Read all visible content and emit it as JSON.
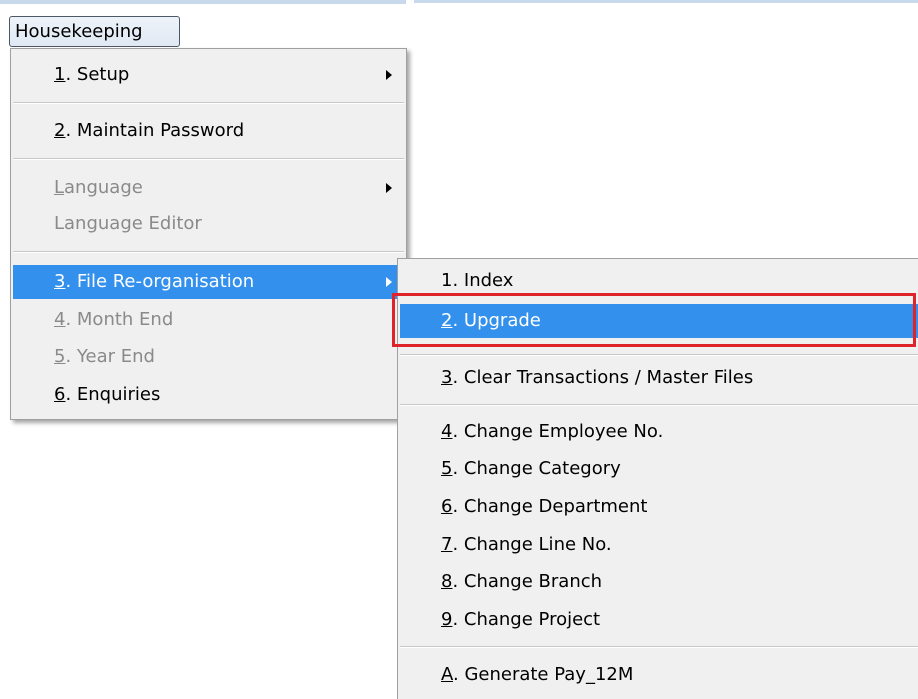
{
  "menubar": {
    "label": "Housekeeping"
  },
  "menu": {
    "items": [
      {
        "mn": "1",
        "rest": ". Setup",
        "submenu": true,
        "disabled": false
      },
      {
        "mn": "2",
        "rest": ". Maintain Password",
        "submenu": false,
        "disabled": false
      },
      {
        "mn": "L",
        "rest": "anguage",
        "submenu": true,
        "disabled": true
      },
      {
        "mn": "",
        "rest": "Language Editor",
        "submenu": false,
        "disabled": true
      },
      {
        "mn": "3",
        "rest": ". File Re-organisation",
        "submenu": true,
        "disabled": false,
        "highlighted": true
      },
      {
        "mn": "4",
        "rest": ". Month End",
        "submenu": false,
        "disabled": true
      },
      {
        "mn": "5",
        "rest": ". Year End",
        "submenu": false,
        "disabled": true
      },
      {
        "mn": "6",
        "rest": ". Enquiries",
        "submenu": false,
        "disabled": false
      }
    ]
  },
  "submenu": {
    "items": [
      {
        "mn": "",
        "rest": "1. Index"
      },
      {
        "mn": "2",
        "rest": ". Upgrade",
        "highlighted": true
      },
      {
        "mn": "3",
        "rest": ". Clear Transactions / Master Files"
      },
      {
        "mn": "4",
        "rest": ". Change Employee No."
      },
      {
        "mn": "5",
        "rest": ". Change Category"
      },
      {
        "mn": "6",
        "rest": ". Change Department"
      },
      {
        "mn": "7",
        "rest": ". Change Line No."
      },
      {
        "mn": "8",
        "rest": ". Change Branch"
      },
      {
        "mn": "9",
        "rest": ". Change Project"
      },
      {
        "mn": "A",
        "rest": ". Generate Pay_12M"
      }
    ]
  },
  "colors": {
    "highlight": "#3390ec",
    "annotation": "#e0232b",
    "menu_background": "#f0f0f0",
    "disabled_text": "#8a8a8a"
  }
}
